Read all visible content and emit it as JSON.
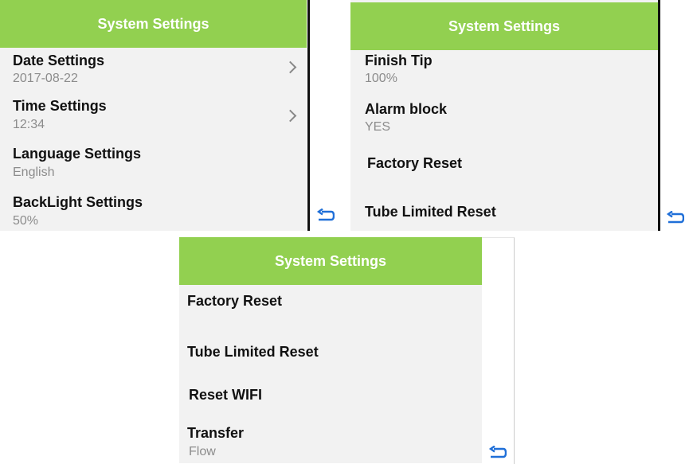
{
  "screens": [
    {
      "title": "System Settings",
      "items": [
        {
          "label": "Date Settings",
          "value": "2017-08-22"
        },
        {
          "label": "Time Settings",
          "value": "12:34"
        },
        {
          "label": "Language Settings",
          "value": "English"
        },
        {
          "label": "BackLight Settings",
          "value": "50%"
        }
      ]
    },
    {
      "title": "System Settings",
      "items": [
        {
          "label": "Finish Tip",
          "value": "100%"
        },
        {
          "label": "Alarm block",
          "value": "YES"
        },
        {
          "label": "Factory Reset"
        },
        {
          "label": "Tube Limited Reset"
        }
      ]
    },
    {
      "title": "System Settings",
      "items": [
        {
          "label": "Factory Reset"
        },
        {
          "label": "Tube Limited Reset"
        },
        {
          "label": "Reset WIFI"
        },
        {
          "label": "Transfer",
          "value": "Flow"
        }
      ]
    }
  ],
  "icons": {
    "chevron": "chevron-right-icon",
    "back": "back-arrow-icon"
  },
  "colors": {
    "header_bg": "#92d050",
    "header_text": "#ffffff",
    "screen_bg": "#f2f2f2",
    "label_text": "#111111",
    "value_text": "#8c8c8c",
    "back_icon": "#1f6fd8"
  }
}
